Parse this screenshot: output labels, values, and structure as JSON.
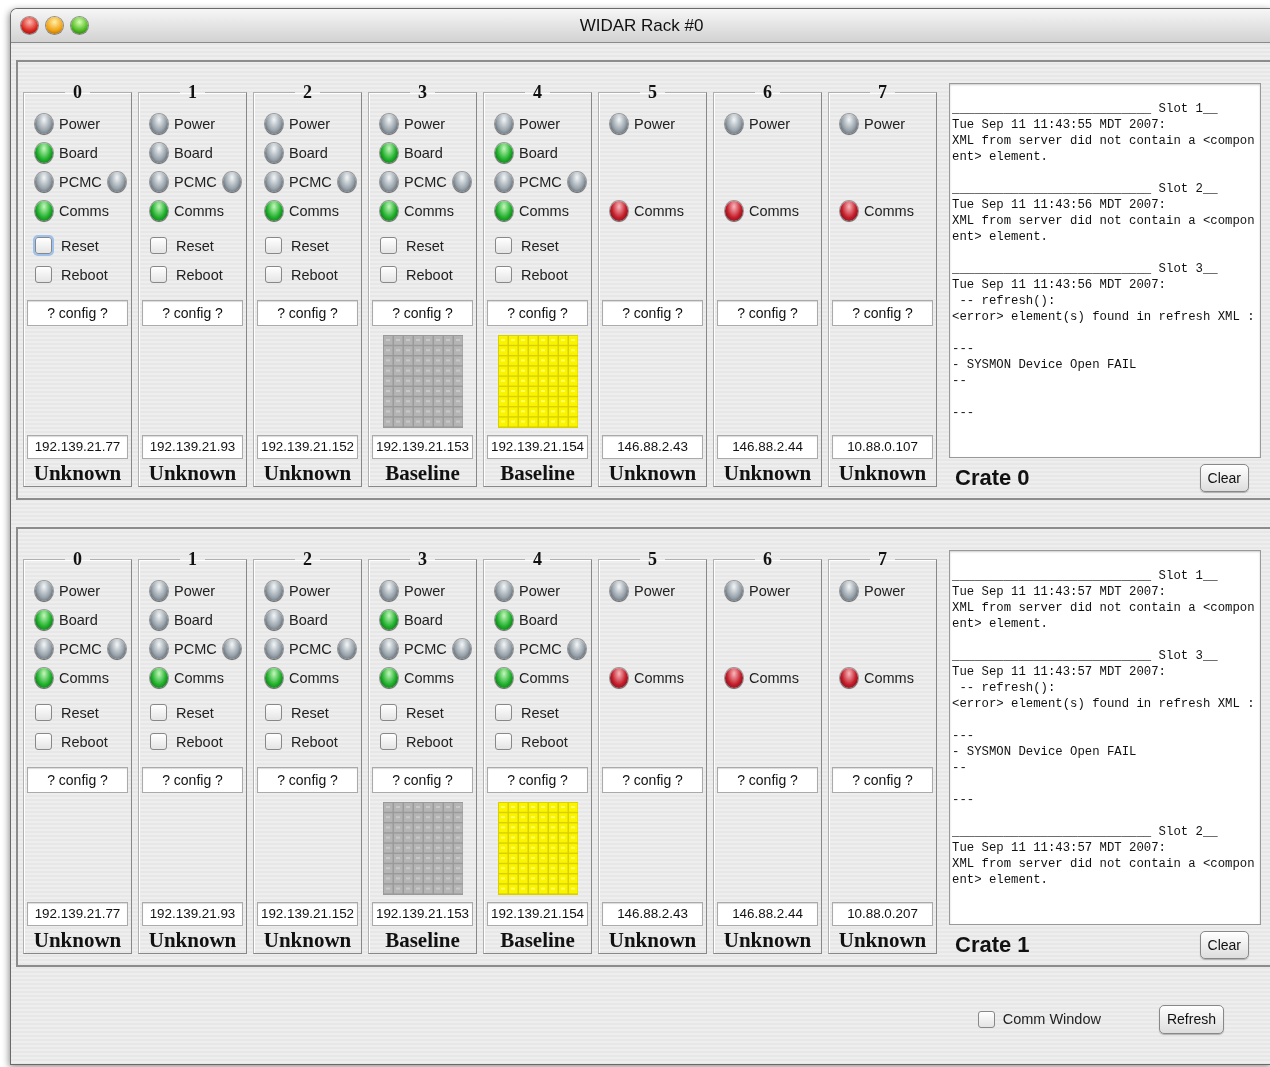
{
  "window": {
    "title": "WIDAR Rack #0"
  },
  "crates": [
    {
      "title": "Crate 0",
      "clear_button": "Clear",
      "slots": [
        {
          "number": "0",
          "indicators": [
            {
              "kind": "power",
              "label": "Power",
              "lit": false,
              "fault": false
            },
            {
              "kind": "board",
              "label": "Board",
              "lit": true,
              "fault": false
            },
            {
              "kind": "pcmc",
              "label": "PCMC",
              "lit": false,
              "fault": false,
              "second_lit": false
            },
            {
              "kind": "comms",
              "label": "Comms",
              "lit": true,
              "fault": false
            }
          ],
          "checkboxes": [
            {
              "label": "Reset",
              "checked": false,
              "focused": true
            },
            {
              "label": "Reboot",
              "checked": false,
              "focused": false
            }
          ],
          "config": "? config ?",
          "ip": "192.139.21.77",
          "status": "Unknown"
        },
        {
          "number": "1",
          "indicators": [
            {
              "kind": "power",
              "label": "Power",
              "lit": false,
              "fault": false
            },
            {
              "kind": "board",
              "label": "Board",
              "lit": false,
              "fault": false
            },
            {
              "kind": "pcmc",
              "label": "PCMC",
              "lit": false,
              "fault": false,
              "second_lit": false
            },
            {
              "kind": "comms",
              "label": "Comms",
              "lit": true,
              "fault": false
            }
          ],
          "checkboxes": [
            {
              "label": "Reset",
              "checked": false,
              "focused": false
            },
            {
              "label": "Reboot",
              "checked": false,
              "focused": false
            }
          ],
          "config": "? config ?",
          "ip": "192.139.21.93",
          "status": "Unknown"
        },
        {
          "number": "2",
          "indicators": [
            {
              "kind": "power",
              "label": "Power",
              "lit": false,
              "fault": false
            },
            {
              "kind": "board",
              "label": "Board",
              "lit": false,
              "fault": false
            },
            {
              "kind": "pcmc",
              "label": "PCMC",
              "lit": false,
              "fault": false,
              "second_lit": false
            },
            {
              "kind": "comms",
              "label": "Comms",
              "lit": true,
              "fault": false
            }
          ],
          "checkboxes": [
            {
              "label": "Reset",
              "checked": false,
              "focused": false
            },
            {
              "label": "Reboot",
              "checked": false,
              "focused": false
            }
          ],
          "config": "? config ?",
          "ip": "192.139.21.152",
          "status": "Unknown"
        },
        {
          "number": "3",
          "indicators": [
            {
              "kind": "power",
              "label": "Power",
              "lit": false,
              "fault": false
            },
            {
              "kind": "board",
              "label": "Board",
              "lit": true,
              "fault": false
            },
            {
              "kind": "pcmc",
              "label": "PCMC",
              "lit": false,
              "fault": false,
              "second_lit": false
            },
            {
              "kind": "comms",
              "label": "Comms",
              "lit": true,
              "fault": false
            }
          ],
          "checkboxes": [
            {
              "label": "Reset",
              "checked": false,
              "focused": false
            },
            {
              "label": "Reboot",
              "checked": false,
              "focused": false
            }
          ],
          "config": "? config ?",
          "matrix": {
            "lit": false
          },
          "ip": "192.139.21.153",
          "status": "Baseline"
        },
        {
          "number": "4",
          "indicators": [
            {
              "kind": "power",
              "label": "Power",
              "lit": false,
              "fault": false
            },
            {
              "kind": "board",
              "label": "Board",
              "lit": true,
              "fault": false
            },
            {
              "kind": "pcmc",
              "label": "PCMC",
              "lit": false,
              "fault": false,
              "second_lit": false
            },
            {
              "kind": "comms",
              "label": "Comms",
              "lit": true,
              "fault": false
            }
          ],
          "checkboxes": [
            {
              "label": "Reset",
              "checked": false,
              "focused": false
            },
            {
              "label": "Reboot",
              "checked": false,
              "focused": false
            }
          ],
          "config": "? config ?",
          "matrix": {
            "lit": true
          },
          "ip": "192.139.21.154",
          "status": "Baseline"
        },
        {
          "number": "5",
          "indicators": [
            {
              "kind": "power",
              "label": "Power",
              "lit": false,
              "fault": false
            },
            {
              "kind": "comms",
              "label": "Comms",
              "lit": true,
              "fault": true
            }
          ],
          "config": "? config ?",
          "ip": "146.88.2.43",
          "status": "Unknown"
        },
        {
          "number": "6",
          "indicators": [
            {
              "kind": "power",
              "label": "Power",
              "lit": false,
              "fault": false
            },
            {
              "kind": "comms",
              "label": "Comms",
              "lit": true,
              "fault": true
            }
          ],
          "config": "? config ?",
          "ip": "146.88.2.44",
          "status": "Unknown"
        },
        {
          "number": "7",
          "indicators": [
            {
              "kind": "power",
              "label": "Power",
              "lit": false,
              "fault": false
            },
            {
              "kind": "comms",
              "label": "Comms",
              "lit": true,
              "fault": true
            }
          ],
          "config": "? config ?",
          "ip": "10.88.0.107",
          "status": "Unknown"
        }
      ],
      "log": [
        {
          "header": "___________________________ Slot 1__",
          "blocks": [
            [
              "Tue Sep 11 11:43:55 MDT 2007:",
              "XML from server did not contain a <compon",
              "ent> element."
            ]
          ]
        },
        {
          "header": "___________________________ Slot 2__",
          "blocks": [
            [
              "Tue Sep 11 11:43:56 MDT 2007:",
              "XML from server did not contain a <compon",
              "ent> element."
            ]
          ]
        },
        {
          "header": "___________________________ Slot 3__",
          "blocks": [
            [
              "Tue Sep 11 11:43:56 MDT 2007:",
              " -- refresh():",
              "<error> element(s) found in refresh XML :"
            ],
            [
              "---",
              "- SYSMON Device Open FAIL",
              "--"
            ],
            [
              "---"
            ]
          ]
        }
      ]
    },
    {
      "title": "Crate 1",
      "clear_button": "Clear",
      "slots": [
        {
          "number": "0",
          "indicators": [
            {
              "kind": "power",
              "label": "Power",
              "lit": false,
              "fault": false
            },
            {
              "kind": "board",
              "label": "Board",
              "lit": true,
              "fault": false
            },
            {
              "kind": "pcmc",
              "label": "PCMC",
              "lit": false,
              "fault": false,
              "second_lit": false
            },
            {
              "kind": "comms",
              "label": "Comms",
              "lit": true,
              "fault": false
            }
          ],
          "checkboxes": [
            {
              "label": "Reset",
              "checked": false,
              "focused": false
            },
            {
              "label": "Reboot",
              "checked": false,
              "focused": false
            }
          ],
          "config": "? config ?",
          "ip": "192.139.21.77",
          "status": "Unknown"
        },
        {
          "number": "1",
          "indicators": [
            {
              "kind": "power",
              "label": "Power",
              "lit": false,
              "fault": false
            },
            {
              "kind": "board",
              "label": "Board",
              "lit": false,
              "fault": false
            },
            {
              "kind": "pcmc",
              "label": "PCMC",
              "lit": false,
              "fault": false,
              "second_lit": false
            },
            {
              "kind": "comms",
              "label": "Comms",
              "lit": true,
              "fault": false
            }
          ],
          "checkboxes": [
            {
              "label": "Reset",
              "checked": false,
              "focused": false
            },
            {
              "label": "Reboot",
              "checked": false,
              "focused": false
            }
          ],
          "config": "? config ?",
          "ip": "192.139.21.93",
          "status": "Unknown"
        },
        {
          "number": "2",
          "indicators": [
            {
              "kind": "power",
              "label": "Power",
              "lit": false,
              "fault": false
            },
            {
              "kind": "board",
              "label": "Board",
              "lit": false,
              "fault": false
            },
            {
              "kind": "pcmc",
              "label": "PCMC",
              "lit": false,
              "fault": false,
              "second_lit": false
            },
            {
              "kind": "comms",
              "label": "Comms",
              "lit": true,
              "fault": false
            }
          ],
          "checkboxes": [
            {
              "label": "Reset",
              "checked": false,
              "focused": false
            },
            {
              "label": "Reboot",
              "checked": false,
              "focused": false
            }
          ],
          "config": "? config ?",
          "ip": "192.139.21.152",
          "status": "Unknown"
        },
        {
          "number": "3",
          "indicators": [
            {
              "kind": "power",
              "label": "Power",
              "lit": false,
              "fault": false
            },
            {
              "kind": "board",
              "label": "Board",
              "lit": true,
              "fault": false
            },
            {
              "kind": "pcmc",
              "label": "PCMC",
              "lit": false,
              "fault": false,
              "second_lit": false
            },
            {
              "kind": "comms",
              "label": "Comms",
              "lit": true,
              "fault": false
            }
          ],
          "checkboxes": [
            {
              "label": "Reset",
              "checked": false,
              "focused": false
            },
            {
              "label": "Reboot",
              "checked": false,
              "focused": false
            }
          ],
          "config": "? config ?",
          "matrix": {
            "lit": false
          },
          "ip": "192.139.21.153",
          "status": "Baseline"
        },
        {
          "number": "4",
          "indicators": [
            {
              "kind": "power",
              "label": "Power",
              "lit": false,
              "fault": false
            },
            {
              "kind": "board",
              "label": "Board",
              "lit": true,
              "fault": false
            },
            {
              "kind": "pcmc",
              "label": "PCMC",
              "lit": false,
              "fault": false,
              "second_lit": false
            },
            {
              "kind": "comms",
              "label": "Comms",
              "lit": true,
              "fault": false
            }
          ],
          "checkboxes": [
            {
              "label": "Reset",
              "checked": false,
              "focused": false
            },
            {
              "label": "Reboot",
              "checked": false,
              "focused": false
            }
          ],
          "config": "? config ?",
          "matrix": {
            "lit": true
          },
          "ip": "192.139.21.154",
          "status": "Baseline"
        },
        {
          "number": "5",
          "indicators": [
            {
              "kind": "power",
              "label": "Power",
              "lit": false,
              "fault": false
            },
            {
              "kind": "comms",
              "label": "Comms",
              "lit": true,
              "fault": true
            }
          ],
          "config": "? config ?",
          "ip": "146.88.2.43",
          "status": "Unknown"
        },
        {
          "number": "6",
          "indicators": [
            {
              "kind": "power",
              "label": "Power",
              "lit": false,
              "fault": false
            },
            {
              "kind": "comms",
              "label": "Comms",
              "lit": true,
              "fault": true
            }
          ],
          "config": "? config ?",
          "ip": "146.88.2.44",
          "status": "Unknown"
        },
        {
          "number": "7",
          "indicators": [
            {
              "kind": "power",
              "label": "Power",
              "lit": false,
              "fault": false
            },
            {
              "kind": "comms",
              "label": "Comms",
              "lit": true,
              "fault": true
            }
          ],
          "config": "? config ?",
          "ip": "10.88.0.207",
          "status": "Unknown"
        }
      ],
      "log": [
        {
          "header": "___________________________ Slot 1__",
          "blocks": [
            [
              "Tue Sep 11 11:43:57 MDT 2007:",
              "XML from server did not contain a <compon",
              "ent> element."
            ]
          ]
        },
        {
          "header": "___________________________ Slot 3__",
          "blocks": [
            [
              "Tue Sep 11 11:43:57 MDT 2007:",
              " -- refresh():",
              "<error> element(s) found in refresh XML :"
            ],
            [
              "---",
              "- SYSMON Device Open FAIL",
              "--"
            ],
            [
              "---"
            ]
          ]
        },
        {
          "header": "___________________________ Slot 2__",
          "blocks": [
            [
              "Tue Sep 11 11:43:57 MDT 2007:",
              "XML from server did not contain a <compon",
              "ent> element."
            ]
          ]
        }
      ]
    }
  ],
  "comm_window": {
    "label": "Comm Window",
    "checked": false
  },
  "refresh_button": "Refresh"
}
